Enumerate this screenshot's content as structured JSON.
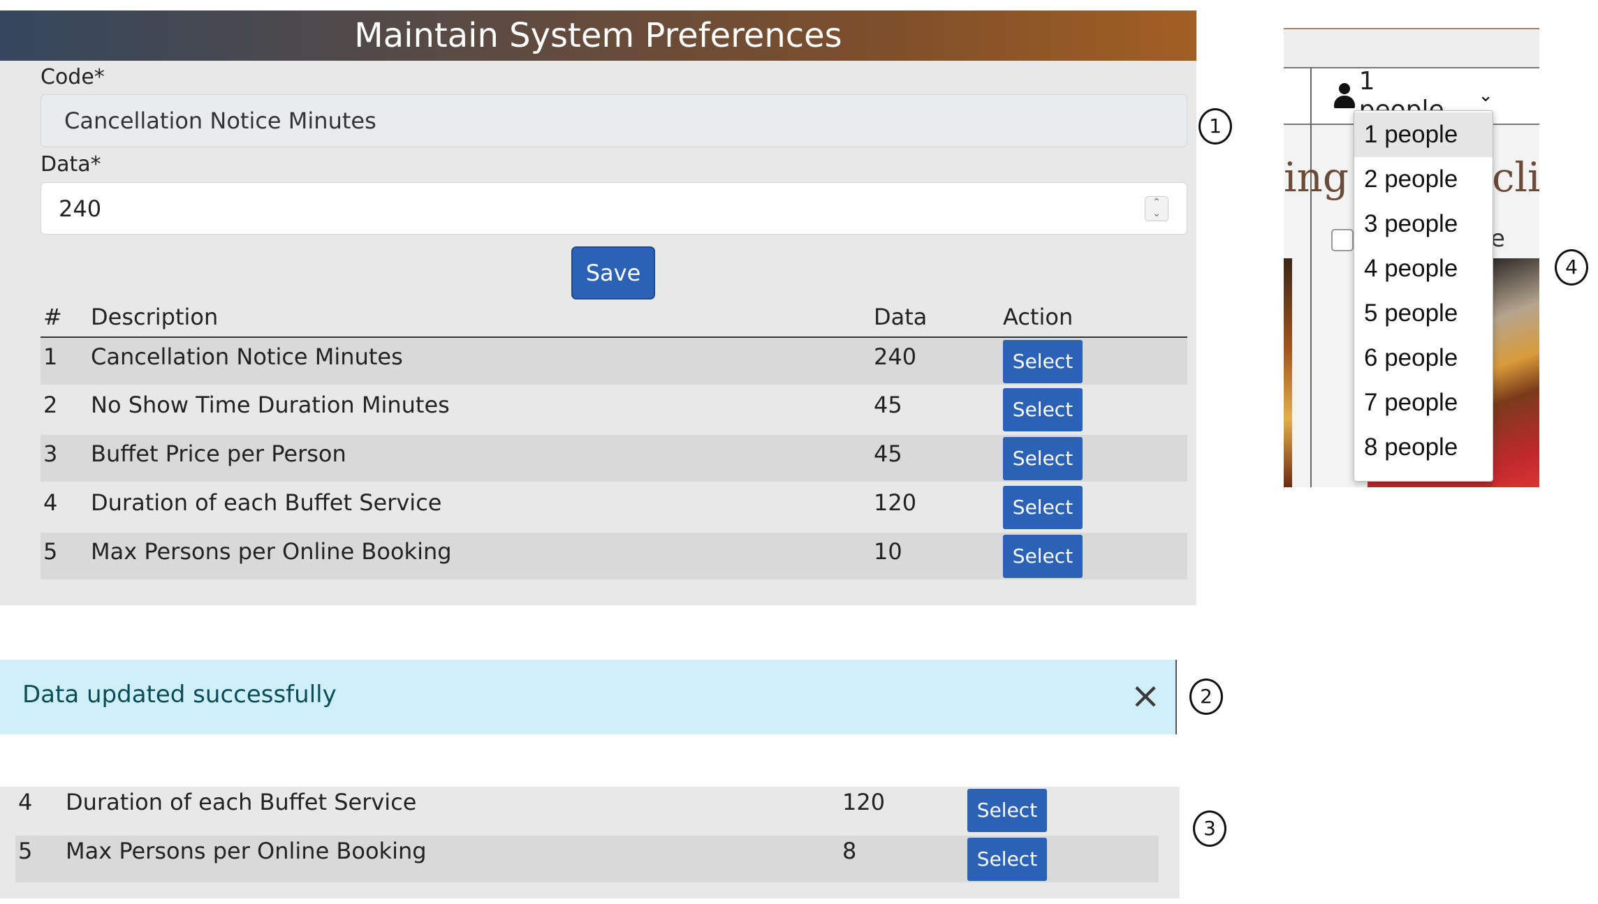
{
  "panel1": {
    "title": "Maintain System Preferences",
    "code_label": "Code*",
    "code_value": "Cancellation Notice Minutes",
    "data_label": "Data*",
    "data_value": "240",
    "save_label": "Save",
    "table": {
      "headers": [
        "#",
        "Description",
        "Data",
        "Action"
      ],
      "rows": [
        {
          "num": "1",
          "description": "Cancellation Notice Minutes",
          "data": "240",
          "action": "Select"
        },
        {
          "num": "2",
          "description": "No Show Time Duration Minutes",
          "data": "45",
          "action": "Select"
        },
        {
          "num": "3",
          "description": "Buffet Price per Person",
          "data": "45",
          "action": "Select"
        },
        {
          "num": "4",
          "description": "Duration of each Buffet Service",
          "data": "120",
          "action": "Select"
        },
        {
          "num": "5",
          "description": "Max Persons per Online Booking",
          "data": "10",
          "action": "Select"
        }
      ]
    }
  },
  "alert": {
    "message": "Data updated successfully",
    "close_glyph": "×"
  },
  "panel3": {
    "rows": [
      {
        "num": "4",
        "description": "Duration of each Buffet Service",
        "data": "120",
        "action": "Select"
      },
      {
        "num": "5",
        "description": "Max Persons per Online Booking",
        "data": "8",
        "action": "Select"
      }
    ]
  },
  "markers": [
    "1",
    "2",
    "3",
    "4"
  ],
  "panel4": {
    "selected": "1 people",
    "partial_text_left": "ing c",
    "partial_text_right": "clic",
    "partial_letter": "e",
    "options": [
      "1 people",
      "2 people",
      "3 people",
      "4 people",
      "5 people",
      "6 people",
      "7 people",
      "8 people"
    ]
  },
  "colors": {
    "primary": "#2b62b5",
    "alert_bg": "#cff0f8",
    "alert_text": "#0a4c5a",
    "panel_bg": "#e8e8e8"
  }
}
